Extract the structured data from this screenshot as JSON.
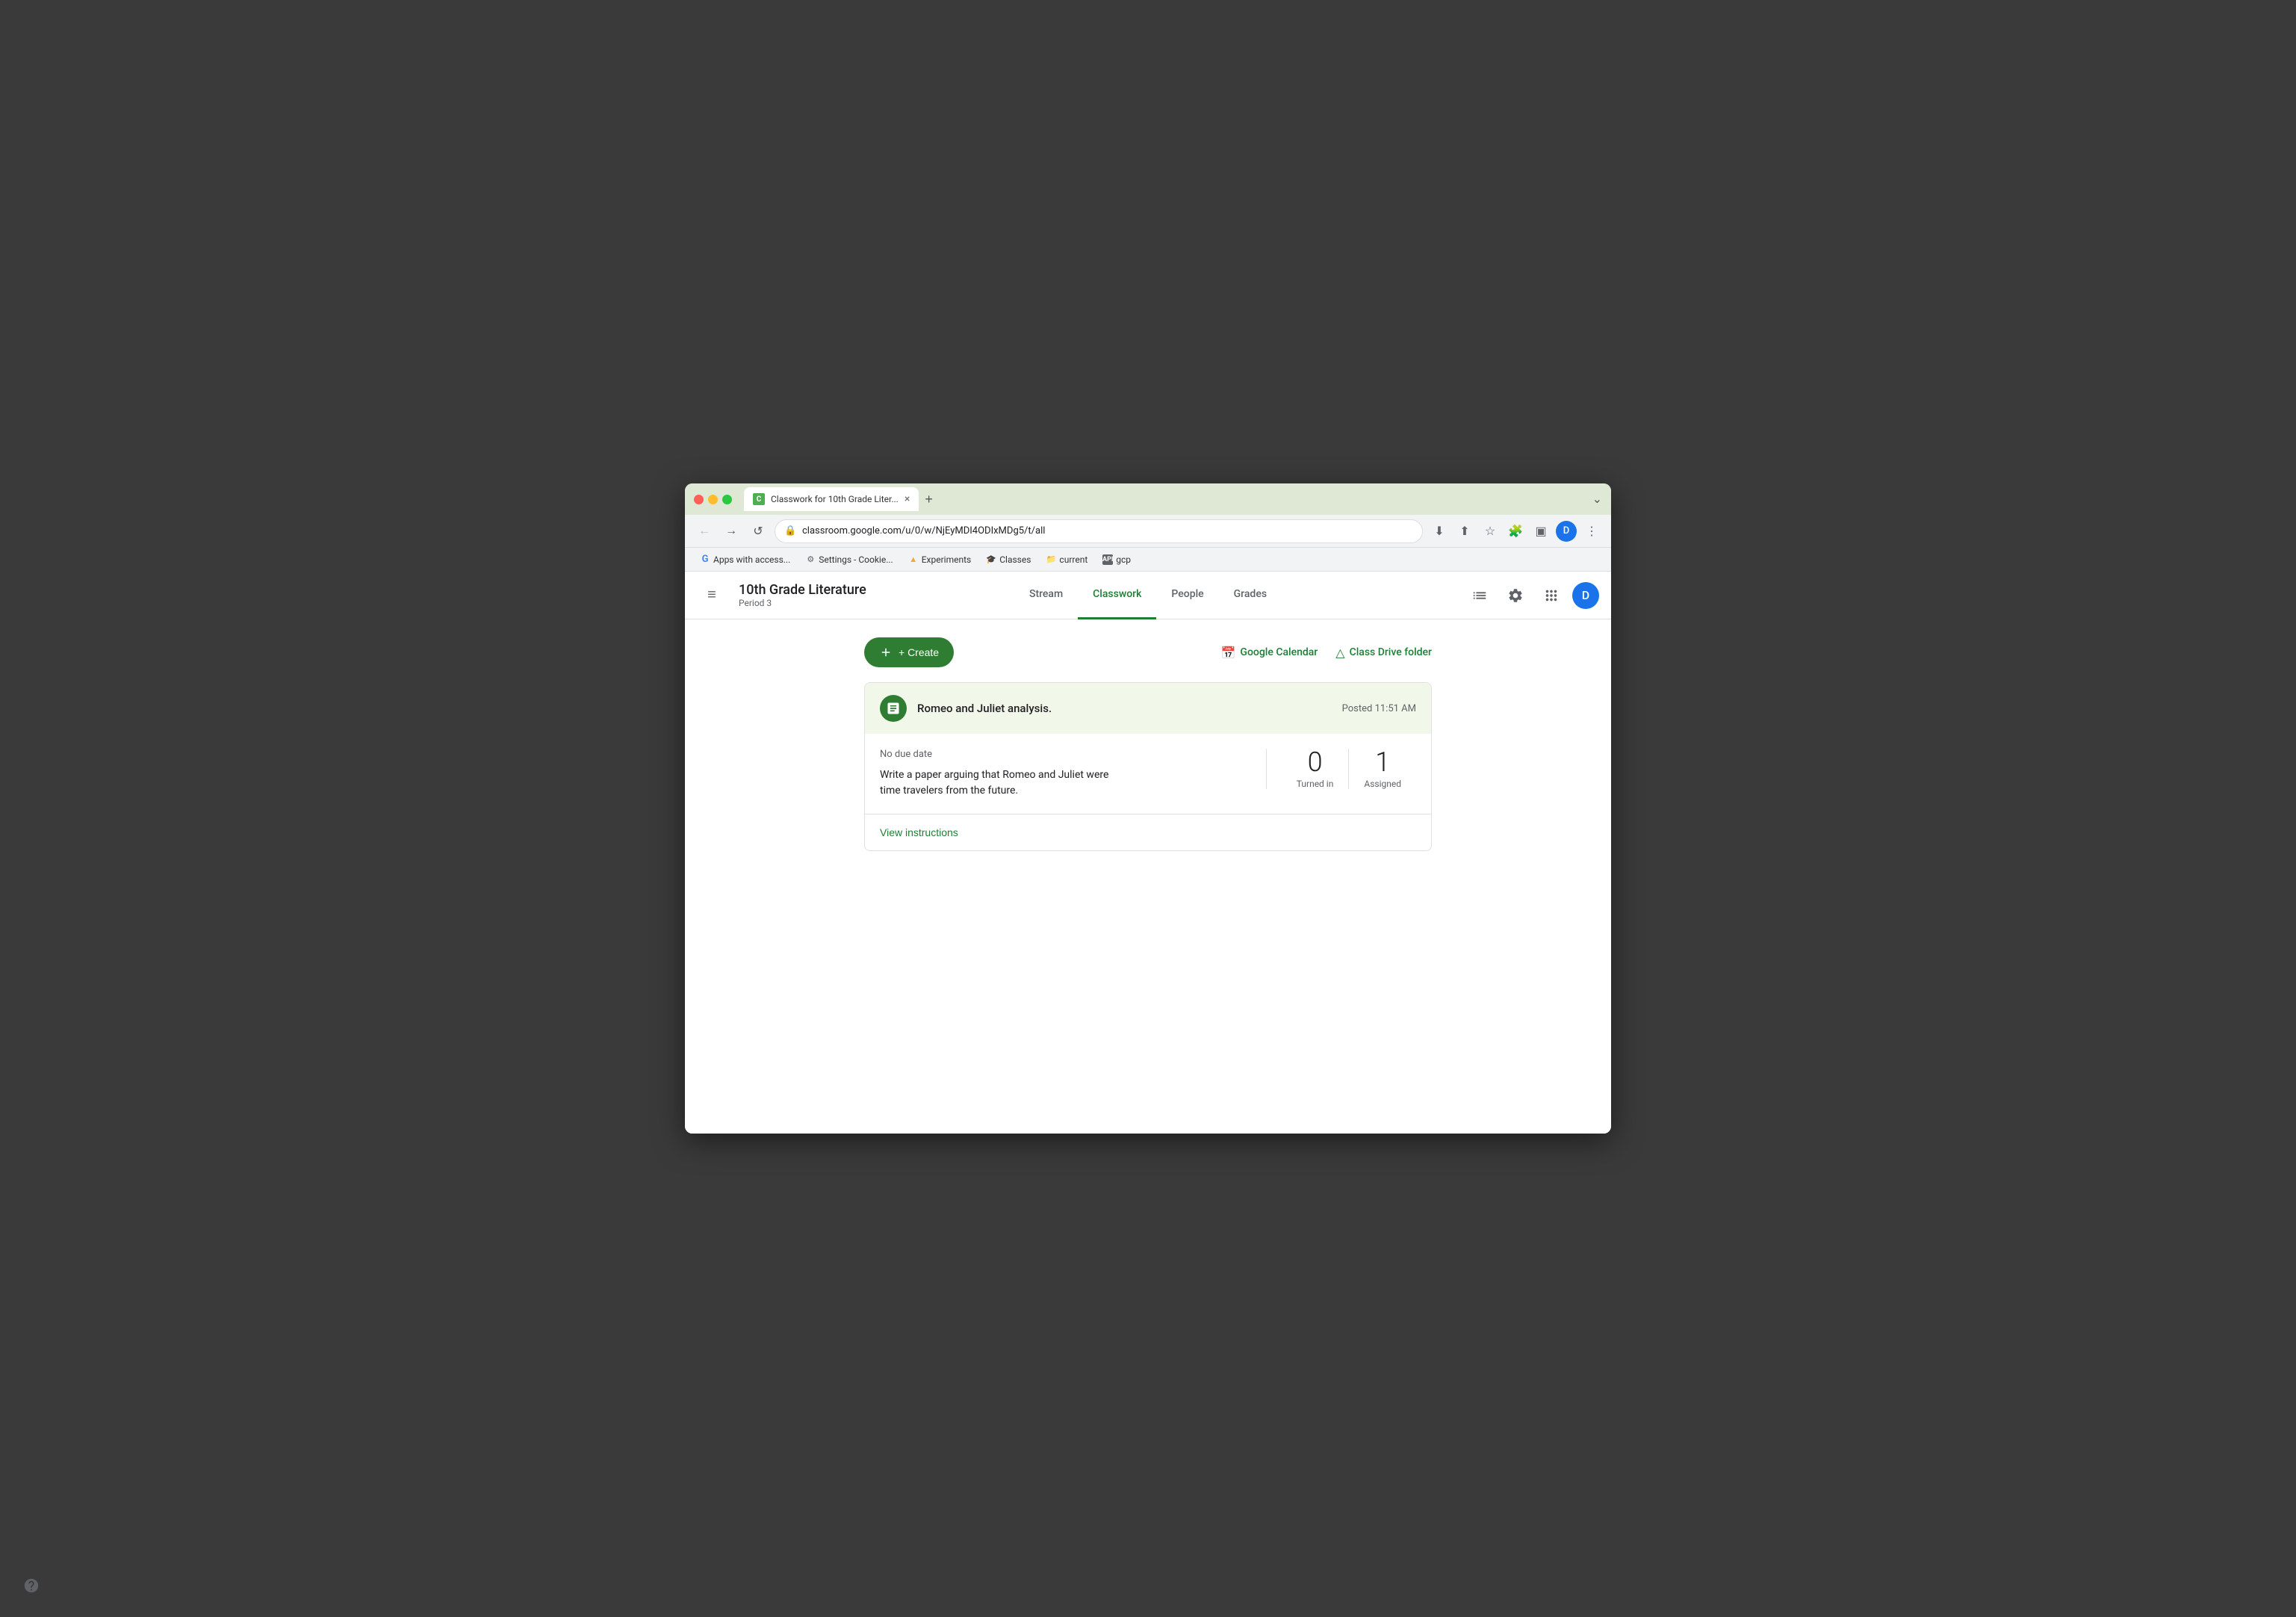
{
  "browser": {
    "tab": {
      "favicon": "C",
      "title": "Classwork for 10th Grade Liter...",
      "close_label": "×"
    },
    "new_tab_label": "+",
    "dropdown_label": "⌄",
    "address_bar": {
      "url": "classroom.google.com/u/0/w/NjEyMDI4ODIxMDg5/t/all",
      "lock_icon": "🔒"
    },
    "nav_buttons": {
      "back": "←",
      "forward": "→",
      "refresh": "↺"
    },
    "address_icons": {
      "download": "⬇",
      "share": "⬆",
      "star": "☆",
      "extension": "🧩",
      "sidebar": "▣",
      "menu": "⋮"
    },
    "profile_initial": "D",
    "bookmarks": [
      {
        "icon": "G",
        "label": "Apps with access...",
        "type": "g"
      },
      {
        "icon": "⚙",
        "label": "Settings - Cookie...",
        "type": "settings"
      },
      {
        "icon": "▲",
        "label": "Experiments",
        "type": "triangle"
      },
      {
        "icon": "🎓",
        "label": "Classes",
        "type": "classes"
      },
      {
        "icon": "📁",
        "label": "current",
        "type": "folder"
      },
      {
        "icon": "API",
        "label": "gcp",
        "type": "api"
      }
    ]
  },
  "app": {
    "header": {
      "hamburger_icon": "≡",
      "class_name": "10th Grade Literature",
      "class_period": "Period 3",
      "nav_tabs": [
        {
          "id": "stream",
          "label": "Stream",
          "active": false
        },
        {
          "id": "classwork",
          "label": "Classwork",
          "active": true
        },
        {
          "id": "people",
          "label": "People",
          "active": false
        },
        {
          "id": "grades",
          "label": "Grades",
          "active": false
        }
      ],
      "actions": {
        "display_icon": "▦",
        "settings_icon": "⚙",
        "grid_icon": "⋮⋮⋮",
        "profile_initial": "D"
      }
    },
    "toolbar": {
      "create_label": "+ Create",
      "calendar_link": "Google Calendar",
      "drive_link": "Class Drive folder",
      "calendar_icon": "📅",
      "drive_icon": "△"
    },
    "assignment": {
      "icon": "📋",
      "title": "Romeo and Juliet analysis.",
      "posted_time": "Posted 11:51 AM",
      "no_due_date": "No due date",
      "description_line1": "Write a paper arguing that Romeo and Juliet were",
      "description_line2": "time travelers from the future.",
      "stats": [
        {
          "number": "0",
          "label": "Turned in"
        },
        {
          "number": "1",
          "label": "Assigned"
        }
      ],
      "footer_link": "View instructions"
    },
    "help_icon": "?"
  }
}
